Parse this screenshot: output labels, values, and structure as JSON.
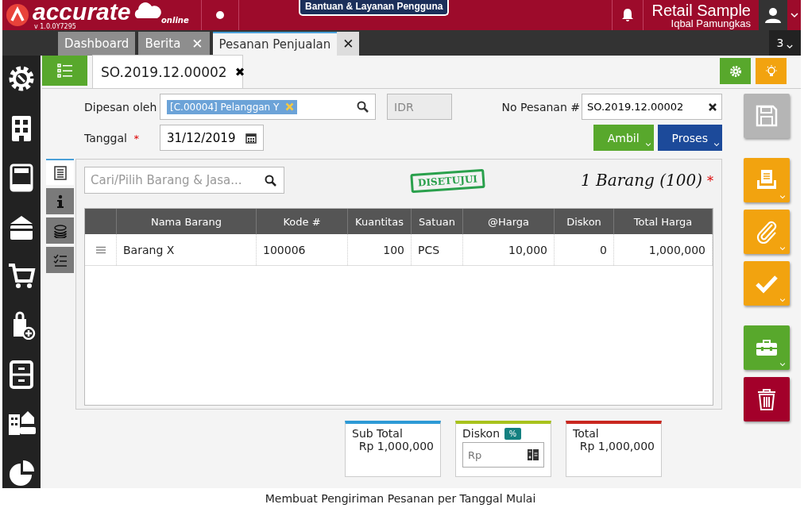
{
  "header": {
    "logo": "accurate",
    "logo_sub": "online",
    "version": "v 1.0.0Y7295",
    "help_button": "Bantuan & Layanan Pengguna",
    "company": "Retail Sample",
    "user": "Iqbal Pamungkas"
  },
  "tabs": [
    {
      "label": "Dashboard",
      "selected": false
    },
    {
      "label": "Berita",
      "selected": false,
      "close": "✕"
    },
    {
      "label": "Pesanan Penjualan",
      "selected": true,
      "close": "✕"
    }
  ],
  "tab_count": "3",
  "document_tab": {
    "label": "SO.2019.12.00002",
    "close": "✖"
  },
  "form": {
    "customer_label": "Dipesan oleh",
    "customer_tag": "[C.00004] Pelanggan Y",
    "currency": "IDR",
    "order_no_label": "No Pesanan #",
    "order_no": "SO.2019.12.00002",
    "date_label": "Tanggal",
    "date_required_mark": "*",
    "date": "31/12/2019",
    "buttons": [
      {
        "label": "Ambil",
        "kind": "green"
      },
      {
        "label": "Proses",
        "kind": "blue"
      }
    ]
  },
  "side_tabs": [
    {
      "kind": "detail",
      "selected": true
    },
    {
      "kind": "info",
      "selected": false
    },
    {
      "kind": "cost",
      "selected": false
    },
    {
      "kind": "list",
      "selected": false
    }
  ],
  "search": {
    "placeholder": "Cari/Pilih Barang & Jasa..."
  },
  "stamp": "DISETUJUI",
  "item_summary": "1 Barang (100)",
  "item_required_mark": "*",
  "table": {
    "columns": [
      {
        "kind": "handle"
      },
      {
        "label": "Nama Barang",
        "kind": "text"
      },
      {
        "label": "Kode #",
        "kind": "text"
      },
      {
        "label": "Kuantitas",
        "kind": "number"
      },
      {
        "label": "Satuan",
        "kind": "text"
      },
      {
        "label": "@Harga",
        "kind": "number"
      },
      {
        "label": "Diskon",
        "kind": "number"
      },
      {
        "label": "Total Harga",
        "kind": "number"
      }
    ],
    "rows": [
      [
        "",
        "Barang X",
        "100006",
        "100",
        "PCS",
        "10,000",
        "0",
        "1,000,000"
      ]
    ]
  },
  "totals": {
    "sub_total_label": "Sub Total",
    "sub_total": "Rp 1,000,000",
    "discount_label": "Diskon",
    "discount_badge": "%",
    "discount_placeholder": "Rp",
    "total_label": "Total",
    "total": "Rp 1,000,000"
  },
  "actions": [
    {
      "kind": "save",
      "disabled": true
    },
    {
      "kind": "print",
      "disabled": false
    },
    {
      "kind": "attach",
      "disabled": false
    },
    {
      "kind": "approve",
      "disabled": false
    },
    {
      "kind": "tools",
      "disabled": false
    },
    {
      "kind": "delete",
      "disabled": false
    }
  ],
  "caption": "Membuat Pengiriman Pesanan per Tanggal Mulai"
}
